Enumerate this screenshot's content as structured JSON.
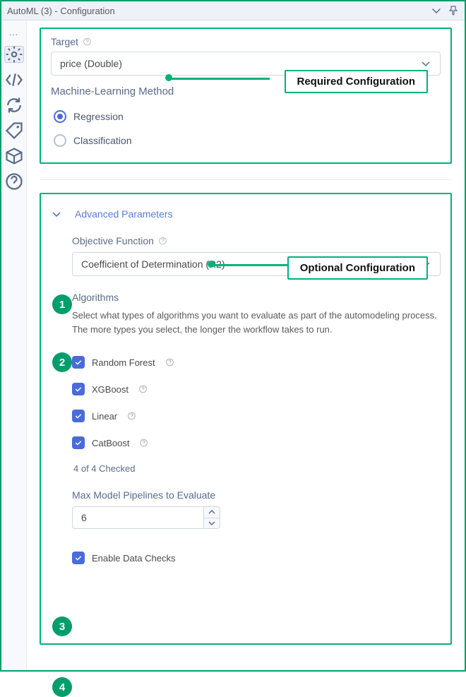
{
  "titlebar": {
    "title": "AutoML (3) - Configuration"
  },
  "required": {
    "target_label": "Target",
    "target_value": "price (Double)",
    "method_label": "Machine-Learning Method",
    "radio_regression": "Regression",
    "radio_classification": "Classification",
    "selected_method": "Regression",
    "callout": "Required Configuration"
  },
  "advanced": {
    "toggle_label": "Advanced Parameters",
    "callout": "Optional Configuration",
    "objective": {
      "label": "Objective Function",
      "value": "Coefficient of Determination (R2)"
    },
    "algorithms": {
      "label": "Algorithms",
      "help": "Select what types of algorithms you want to evaluate as part of the automodeling process. The more types you select, the longer the workflow takes to run.",
      "items": [
        {
          "label": "Random Forest",
          "checked": true
        },
        {
          "label": "XGBoost",
          "checked": true
        },
        {
          "label": "Linear",
          "checked": true
        },
        {
          "label": "CatBoost",
          "checked": true
        }
      ],
      "count_text": "4 of 4 Checked"
    },
    "max_pipelines": {
      "label": "Max Model Pipelines to Evaluate",
      "value": "6"
    },
    "enable_data_checks": {
      "label": "Enable Data Checks",
      "checked": true
    }
  },
  "badges": [
    "1",
    "2",
    "3",
    "4"
  ]
}
